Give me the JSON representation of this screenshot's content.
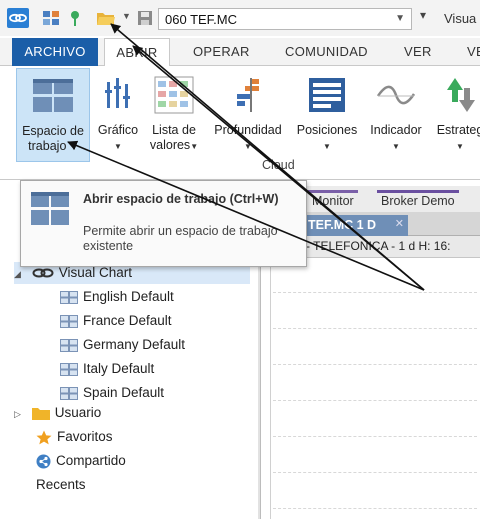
{
  "quick_access": {
    "symbol_value": "060 TEF.MC",
    "customize_glyph": "▾",
    "window_title": "Visua"
  },
  "ribbon_tabs": [
    "ARCHIVO",
    "ABRIR",
    "OPERAR",
    "COMUNIDAD",
    "VER",
    "VE"
  ],
  "ribbon_buttons": {
    "espacio": {
      "line1": "Espacio de",
      "line2": "trabajo"
    },
    "grafico": {
      "line1": "Gráfico"
    },
    "lista": {
      "line1": "Lista de",
      "line2": "valores"
    },
    "profundidad": {
      "line1": "Profundidad"
    },
    "posiciones": {
      "line1": "Posiciones"
    },
    "indicador": {
      "line1": "Indicador"
    },
    "estrategia": {
      "line1": "Estrateg"
    }
  },
  "ribbon_group_label": "Cloud",
  "tooltip": {
    "title": "Abrir espacio de trabajo (Ctrl+W)",
    "description": "Permite abrir un espacio de trabajo existente"
  },
  "doc_tabs": [
    "Monitor",
    "Broker Demo"
  ],
  "chart_tab": {
    "label": "TEF.MC 1 D",
    "close": "✕"
  },
  "chart_caption": "C - TELEFONICA - 1 d H: 16:",
  "tree": {
    "root": "Visual Chart",
    "children": [
      "English Default",
      "France Default",
      "Germany Default",
      "Italy Default",
      "Spain Default"
    ],
    "usuario": "Usuario",
    "favoritos": "Favoritos",
    "compartido": "Compartido",
    "recents": "Recents"
  },
  "colors": {
    "accent": "#1b5ea8",
    "selected_button": "#cce4f7",
    "chart_tab": "#6f8fb7",
    "tree_selected": "#d9e8f8"
  }
}
